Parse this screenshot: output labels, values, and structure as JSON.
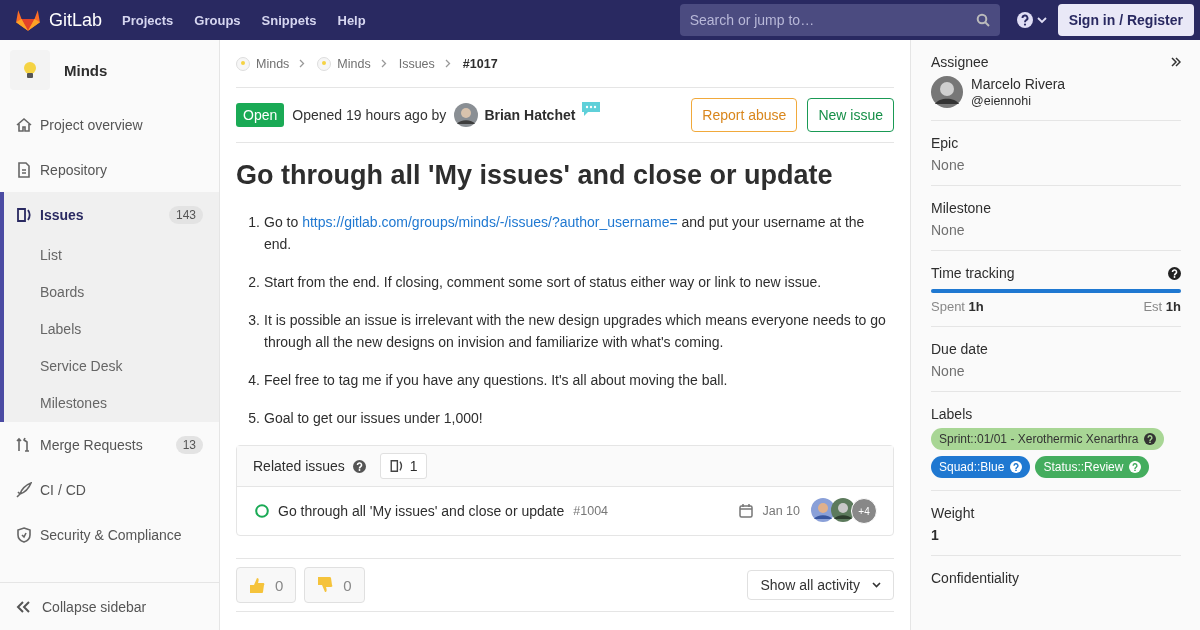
{
  "navbar": {
    "brand": "GitLab",
    "links": [
      "Projects",
      "Groups",
      "Snippets",
      "Help"
    ],
    "search": {
      "placeholder": "Search or jump to…"
    },
    "sign_in": "Sign in / Register"
  },
  "sidebar": {
    "project": "Minds",
    "items": [
      {
        "label": "Project overview",
        "selected": false
      },
      {
        "label": "Repository",
        "selected": false
      },
      {
        "label": "Issues",
        "count": "143",
        "selected": true,
        "children": [
          {
            "label": "List",
            "selected": false
          },
          {
            "label": "Boards",
            "selected": false
          },
          {
            "label": "Labels",
            "selected": false
          },
          {
            "label": "Service Desk",
            "selected": false
          },
          {
            "label": "Milestones",
            "selected": false
          }
        ]
      },
      {
        "label": "Merge Requests",
        "count": "13",
        "selected": false
      },
      {
        "label": "CI / CD",
        "selected": false
      },
      {
        "label": "Security & Compliance",
        "selected": false
      }
    ],
    "collapse": "Collapse sidebar"
  },
  "breadcrumbs": [
    "Minds",
    "Minds",
    "Issues",
    "#1017"
  ],
  "issue": {
    "status": "Open",
    "opened": "Opened 19 hours ago by",
    "author": "Brian Hatchet",
    "actions": [
      "Report abuse",
      "New issue"
    ],
    "title": "Go through all 'My issues' and close or update",
    "steps": [
      {
        "marker": "1.",
        "text": "Go to ",
        "link": "https://gitlab.com/groups/minds/-/issues/?author_username=",
        "after": " and put your username at the end."
      },
      {
        "marker": "2.",
        "text": "Start from the end. If closing, comment some sort of status either way or link to new issue."
      },
      {
        "marker": "3.",
        "text": "It is possible an issue is irrelevant with the new design upgrades which means everyone needs to go through all the new designs on invision and familiarize with what's coming."
      },
      {
        "marker": "4.",
        "text": "Feel free to tag me if you have any questions. It's all about moving the ball."
      },
      {
        "marker": "5.",
        "text": "Goal to get our issues under 1,000!"
      }
    ]
  },
  "related": {
    "title": "Related issues",
    "count": "1",
    "items": [
      {
        "title": "Go through all 'My issues' and close or update",
        "ref": "#1004",
        "date": "Jan 10",
        "more": "+4"
      }
    ]
  },
  "reactions": [
    {
      "kind": "thumbsup",
      "count": "0"
    },
    {
      "kind": "thumbsdown",
      "count": "0"
    }
  ],
  "activity_filter": "Show all activity",
  "right": {
    "assignee": {
      "label": "Assignee",
      "name": "Marcelo Rivera",
      "handle": "@eiennohi"
    },
    "fields": [
      {
        "label": "Epic",
        "value": "None"
      },
      {
        "label": "Milestone",
        "value": "None"
      }
    ],
    "time": {
      "label": "Time tracking",
      "level": 1,
      "spent_label": "Spent",
      "spent": "1h",
      "est_label": "Est",
      "est": "1h"
    },
    "due": {
      "label": "Due date",
      "value": "None"
    },
    "labels": {
      "label": "Labels",
      "items": [
        {
          "text": "Sprint::01/01 - Xerothermic Xenarthra",
          "color": "#a8d695"
        },
        {
          "text": "Squad::Blue",
          "color": "#1f78d1"
        },
        {
          "text": "Status::Review",
          "color": "#44ad5e"
        }
      ]
    },
    "weight": {
      "label": "Weight",
      "value": "1"
    },
    "confidentiality": {
      "label": "Confidentiality"
    }
  }
}
